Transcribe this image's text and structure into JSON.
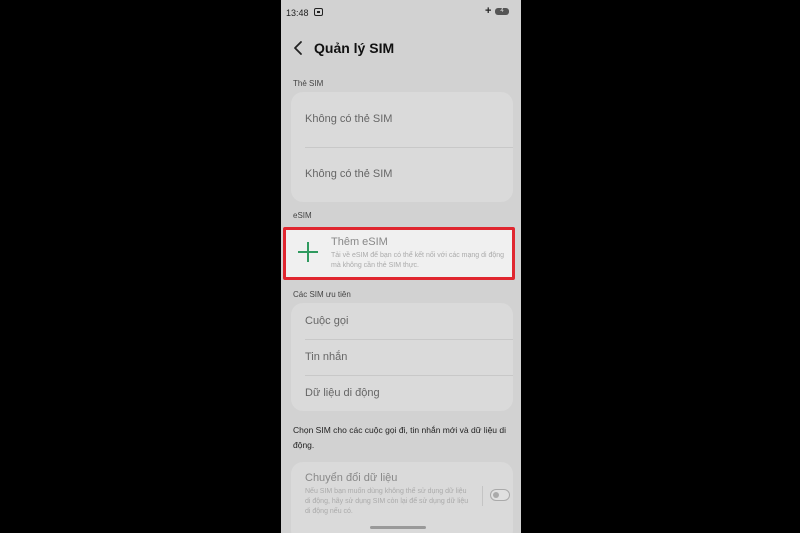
{
  "status_bar": {
    "time": "13:48",
    "signal_symbol": "+",
    "battery_text": "4"
  },
  "header": {
    "title": "Quản lý SIM"
  },
  "sim_cards": {
    "label": "Thẻ SIM",
    "slots": [
      {
        "text": "Không có thẻ SIM"
      },
      {
        "text": "Không có thẻ SIM"
      }
    ]
  },
  "esim": {
    "label": "eSIM",
    "add_title": "Thêm eSIM",
    "add_description": "Tải về eSIM để bạn có thể kết nối với các mạng di động mà không cần thẻ SIM thực.",
    "highlight_color": "#e0262f",
    "icon_color": "#2f9a5f"
  },
  "preferred": {
    "label": "Các SIM ưu tiên",
    "items": [
      {
        "text": "Cuộc gọi"
      },
      {
        "text": "Tin nhắn"
      },
      {
        "text": "Dữ liệu di động"
      }
    ],
    "note": "Chọn SIM cho các cuộc gọi đi, tin nhắn mới và dữ liệu di động."
  },
  "data_switch": {
    "title": "Chuyển đổi dữ liệu",
    "description": "Nếu SIM bạn muốn dùng không thể sử dụng dữ liệu di động, hãy sử dụng SIM còn lại để sử dụng dữ liệu di động nếu có.",
    "enabled": false
  }
}
